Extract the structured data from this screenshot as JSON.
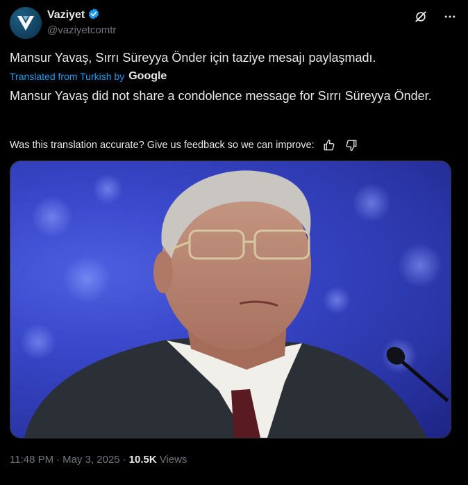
{
  "author": {
    "display_name": "Vaziyet",
    "handle": "@vaziyetcomtr",
    "avatar_icon": "vaziyet-logo-icon",
    "verified_icon": "verified-badge-icon",
    "brand_color": "#1d9bf0"
  },
  "header_actions": {
    "grok_icon": "grok-icon",
    "more_icon": "more-horizontal-icon"
  },
  "tweet": {
    "text": "Mansur Yavaş, Sırrı Süreyya Önder için taziye mesajı paylaşmadı.",
    "translated_label": "Translated from Turkish by",
    "translator": "Google",
    "translation": "Mansur Yavaş did not share a condolence message for Sırrı Süreyya Önder.",
    "feedback_prompt": "Was this translation accurate? Give us feedback so we can improve:",
    "thumbs_up_icon": "thumbs-up-icon",
    "thumbs_down_icon": "thumbs-down-icon"
  },
  "media": {
    "subject": "photo of a man in glasses and suit in front of a microphone"
  },
  "meta": {
    "time": "11:48 PM",
    "separator": "·",
    "date": "May 3, 2025",
    "views_count": "10.5K",
    "views_label": "Views"
  }
}
